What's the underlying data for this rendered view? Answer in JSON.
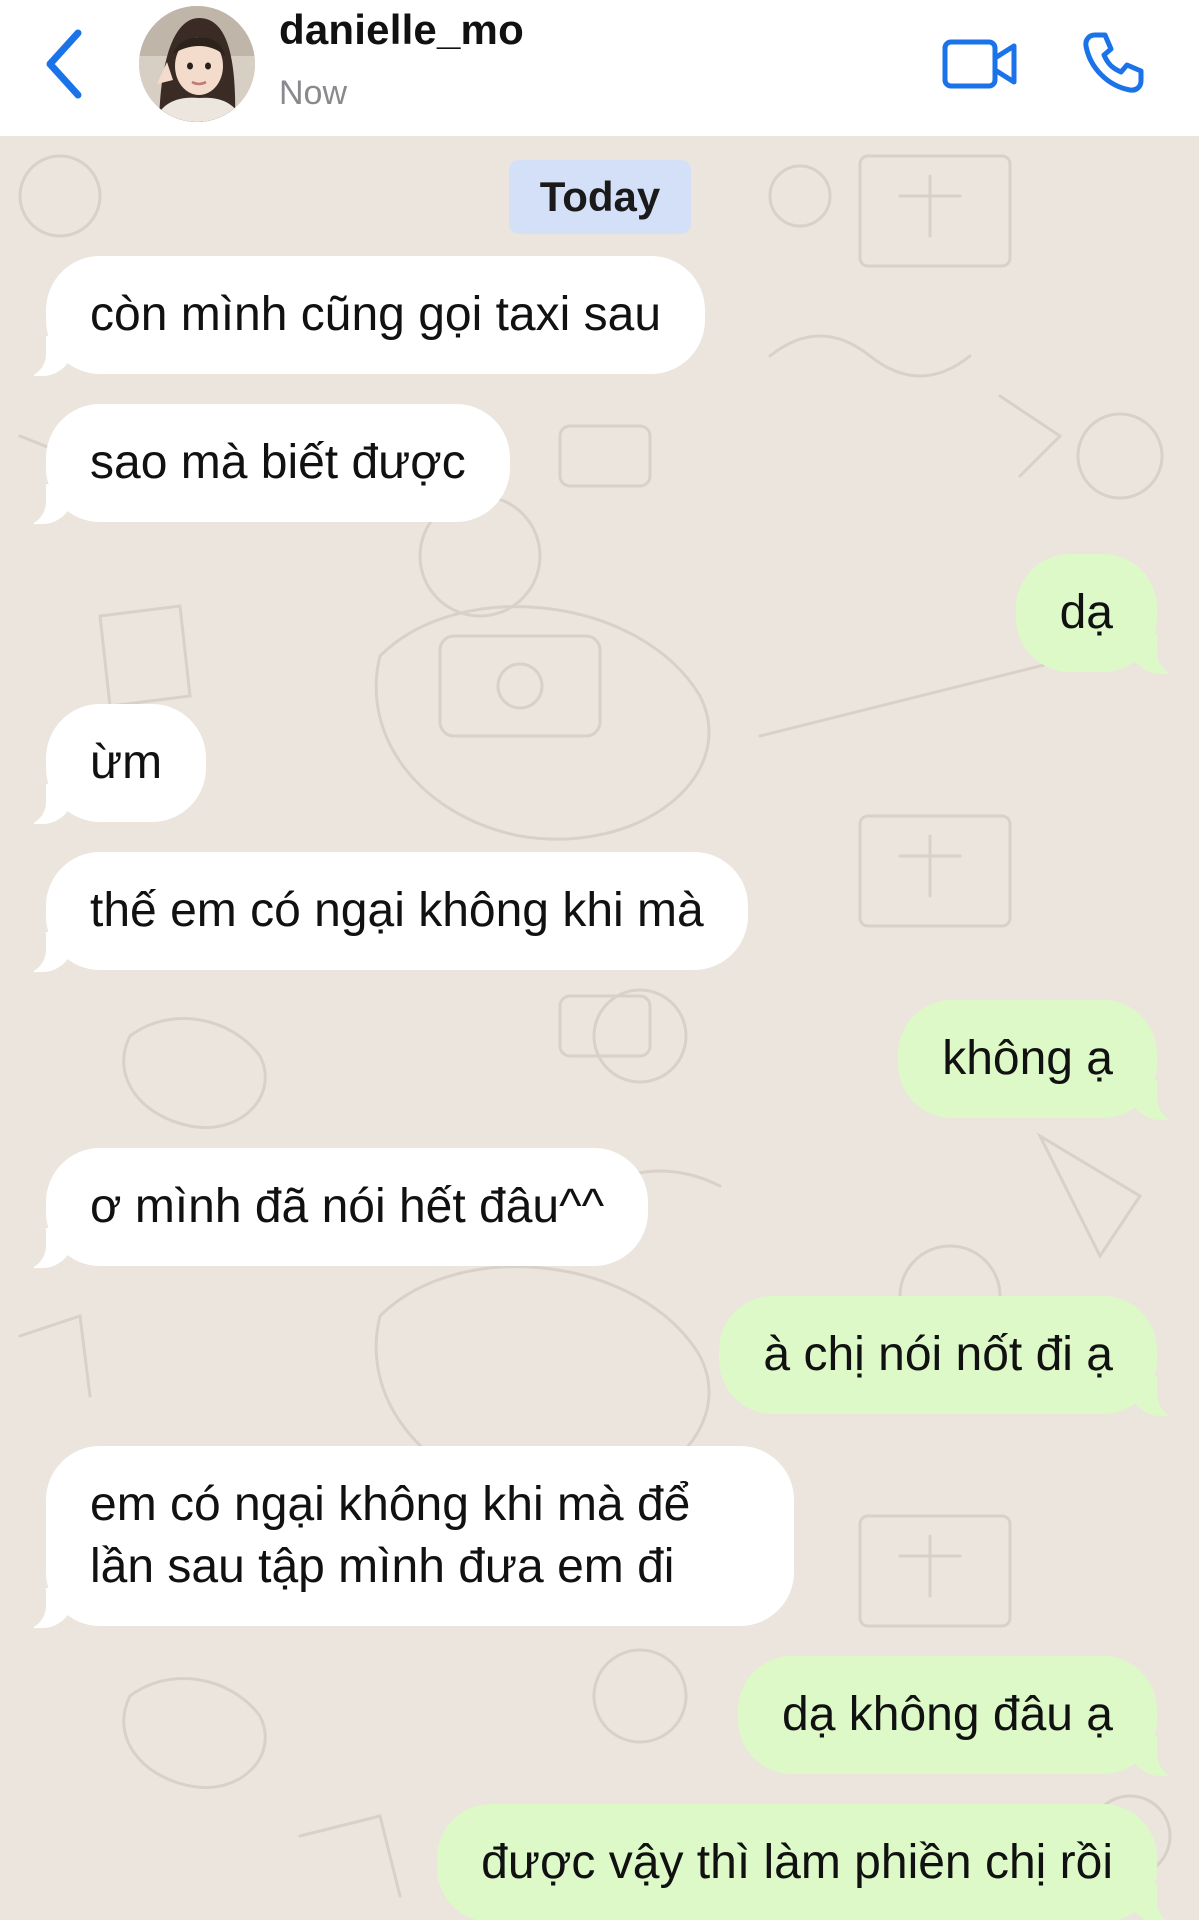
{
  "header": {
    "contact_name": "danielle_mo",
    "status": "Now",
    "back_icon": "chevron-left-icon",
    "video_icon": "video-camera-icon",
    "call_icon": "phone-icon",
    "accent_color": "#1a73e8"
  },
  "chat": {
    "date_label": "Today",
    "incoming_color": "#ffffff",
    "outgoing_color": "#ddf9c8",
    "messages": [
      {
        "direction": "in",
        "text": "còn mình cũng gọi taxi sau"
      },
      {
        "direction": "in",
        "text": "sao mà biết được"
      },
      {
        "direction": "out",
        "text": "dạ"
      },
      {
        "direction": "in",
        "text": "ừm"
      },
      {
        "direction": "in",
        "text": "thế em có ngại không khi mà"
      },
      {
        "direction": "out",
        "text": "không ạ"
      },
      {
        "direction": "in",
        "text": "ơ mình đã nói hết đâu^^"
      },
      {
        "direction": "out",
        "text": "à chị nói nốt đi ạ"
      },
      {
        "direction": "in",
        "text": "em có ngại không khi mà để lần sau tập mình đưa em đi"
      },
      {
        "direction": "out",
        "text": "dạ không đâu ạ"
      },
      {
        "direction": "out",
        "text": "được vậy thì làm phiền chị rồi"
      }
    ]
  }
}
